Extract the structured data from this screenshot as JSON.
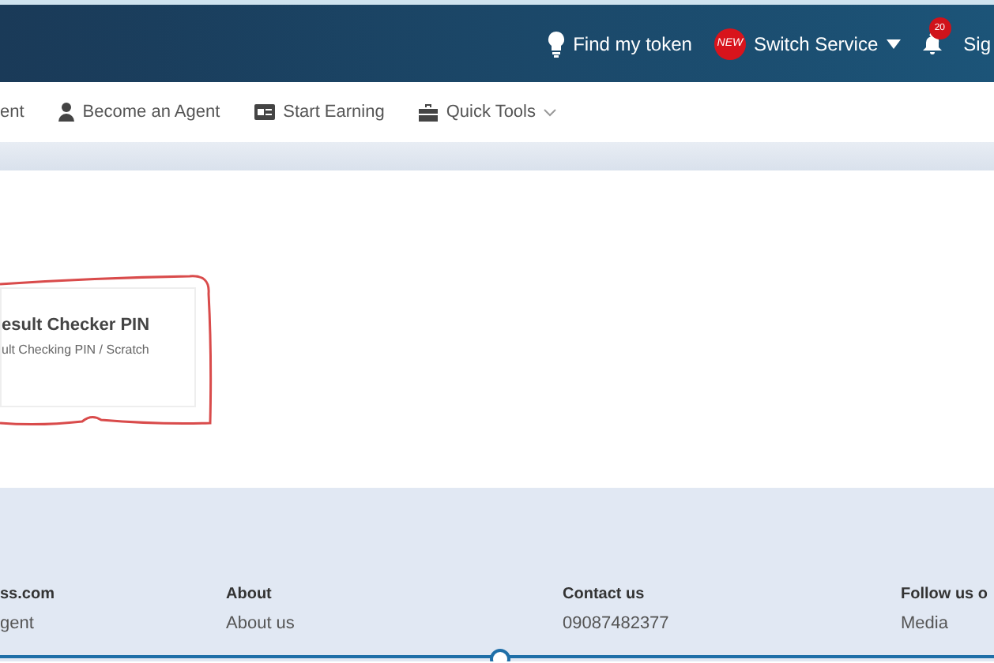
{
  "topbar": {
    "items": [
      {
        "kind": "token",
        "label": "Find my token"
      },
      {
        "kind": "service",
        "badge": "NEW",
        "label": "Switch Service"
      },
      {
        "kind": "bell",
        "count": "20"
      },
      {
        "kind": "sign",
        "label": "Sig"
      }
    ]
  },
  "nav": {
    "items": [
      {
        "kind": "plain",
        "label": "ent"
      },
      {
        "kind": "person",
        "label": "Become an Agent"
      },
      {
        "kind": "card",
        "label": "Start Earning"
      },
      {
        "kind": "tools",
        "label": "Quick Tools"
      }
    ]
  },
  "product_card": {
    "title": "esult Checker PIN",
    "subtitle": "ult Checking PIN / Scratch"
  },
  "footer": {
    "columns": [
      {
        "heading": "ss.com",
        "links": [
          "gent"
        ]
      },
      {
        "heading": "About",
        "links": [
          "About us"
        ]
      },
      {
        "heading": "Contact us",
        "links": [
          "09087482377"
        ]
      },
      {
        "heading": "Follow us o",
        "links": [
          "Media"
        ]
      }
    ]
  }
}
